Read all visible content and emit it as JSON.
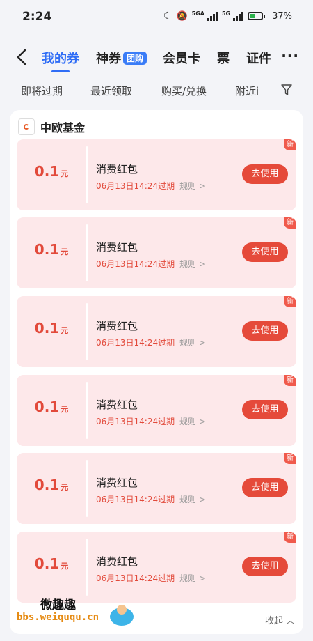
{
  "status_bar": {
    "time": "2:24",
    "network1": "5GA",
    "network2": "5G",
    "battery": "37%"
  },
  "nav": {
    "tabs": [
      {
        "label": "我的券",
        "active": true
      },
      {
        "label": "神券",
        "badge": "团购"
      },
      {
        "label": "会员卡"
      },
      {
        "label": "票"
      },
      {
        "label": "证件"
      }
    ],
    "more": "···"
  },
  "filters": [
    "即将过期",
    "最近领取",
    "购买/兑换",
    "附近i"
  ],
  "brand": {
    "name": "中欧基金",
    "logo_text": "中欧基金"
  },
  "coupons": [
    {
      "amount": "0.1",
      "unit": "元",
      "title": "消费红包",
      "expire": "06月13日14:24过期",
      "rule": "规则 >",
      "action": "去使用",
      "tag": "新"
    },
    {
      "amount": "0.1",
      "unit": "元",
      "title": "消费红包",
      "expire": "06月13日14:24过期",
      "rule": "规则 >",
      "action": "去使用",
      "tag": "新"
    },
    {
      "amount": "0.1",
      "unit": "元",
      "title": "消费红包",
      "expire": "06月13日14:24过期",
      "rule": "规则 >",
      "action": "去使用",
      "tag": "新"
    },
    {
      "amount": "0.1",
      "unit": "元",
      "title": "消费红包",
      "expire": "06月13日14:24过期",
      "rule": "规则 >",
      "action": "去使用",
      "tag": "新"
    },
    {
      "amount": "0.1",
      "unit": "元",
      "title": "消费红包",
      "expire": "06月13日14:24过期",
      "rule": "规则 >",
      "action": "去使用",
      "tag": "新"
    },
    {
      "amount": "0.1",
      "unit": "元",
      "title": "消费红包",
      "expire": "06月13日14:24过期",
      "rule": "规则 >",
      "action": "去使用",
      "tag": "新"
    }
  ],
  "collapse": "收起",
  "watermark": {
    "line1": "微趣趣",
    "line2": "bbs.weiququ.cn"
  },
  "colors": {
    "accent": "#2f6df6",
    "coupon_red": "#e54a3a",
    "coupon_bg": "#fde8ea"
  }
}
